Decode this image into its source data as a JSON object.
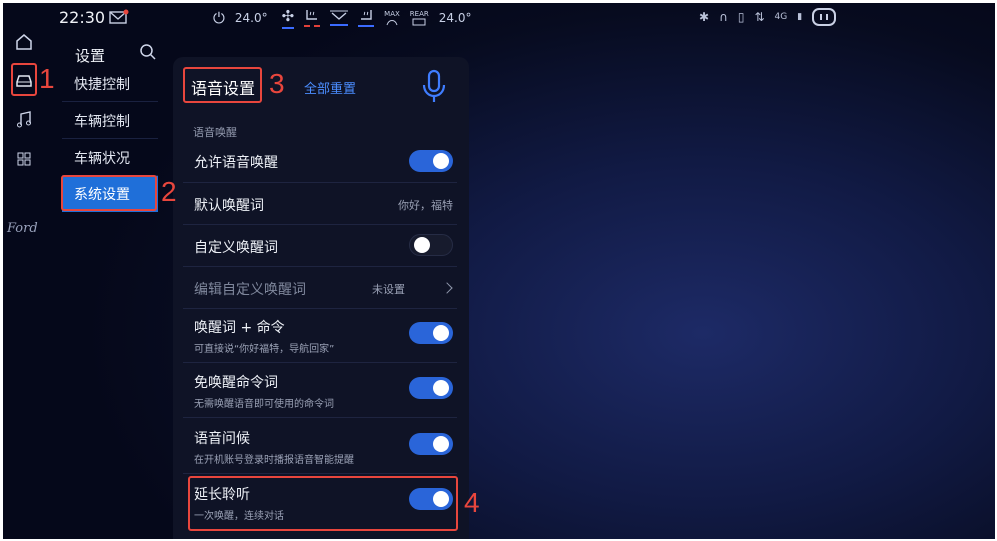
{
  "status_bar": {
    "time": "22:30",
    "temp_left": "24.0°",
    "temp_right": "24.0°",
    "max_label": "MAX",
    "rear_label": "REAR",
    "network_label": "4G"
  },
  "menu": {
    "title": "设置",
    "items": [
      {
        "label": "快捷控制"
      },
      {
        "label": "车辆控制"
      },
      {
        "label": "车辆状况"
      },
      {
        "label": "系统设置"
      }
    ]
  },
  "brand": "Ford",
  "panel": {
    "title": "语音设置",
    "reset_label": "全部重置",
    "section_label": "语音唤醒",
    "rows": [
      {
        "label": "允许语音唤醒",
        "state": "on"
      },
      {
        "label": "默认唤醒词",
        "value": "你好，福特"
      },
      {
        "label": "自定义唤醒词",
        "state": "off"
      },
      {
        "label": "编辑自定义唤醒词",
        "value": "未设置"
      },
      {
        "label": "唤醒词 + 命令",
        "sub": "可直接说“你好福特，导航回家”",
        "state": "on"
      },
      {
        "label": "免唤醒命令词",
        "sub": "无需唤醒语音即可使用的命令词",
        "state": "on"
      },
      {
        "label": "语音问候",
        "sub": "在开机账号登录时播报语音智能提醒",
        "state": "on"
      },
      {
        "label": "延长聆听",
        "sub": "一次唤醒，连续对话",
        "state": "on"
      }
    ]
  },
  "annotations": [
    "1",
    "2",
    "3",
    "4"
  ],
  "colors": {
    "accent": "#2a65d9",
    "annotation": "#e8463d",
    "link": "#4b8dff"
  }
}
